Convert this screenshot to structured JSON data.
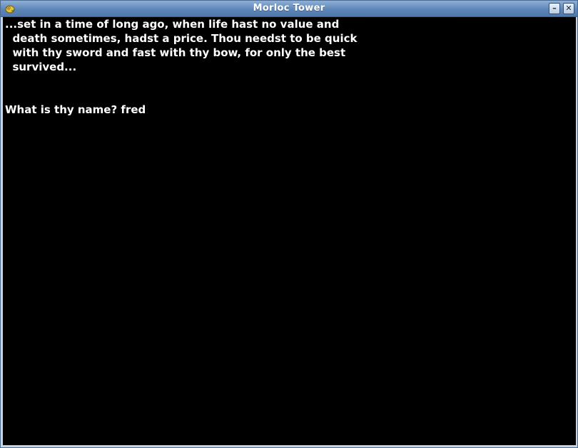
{
  "window": {
    "title": "Morloc Tower",
    "minimize_glyph": "–",
    "close_glyph": "✕"
  },
  "console": {
    "intro_lines": [
      "...set in a time of long ago, when life hast no value and",
      "  death sometimes, hadst a price. Thou needst to be quick",
      "  with thy sword and fast with thy bow, for only the best",
      "  survived..."
    ],
    "prompt": "What is thy name? ",
    "input_value": "fred"
  },
  "colors": {
    "titlebar": "#5d86b8",
    "background": "#000000",
    "text": "#ffffff"
  }
}
